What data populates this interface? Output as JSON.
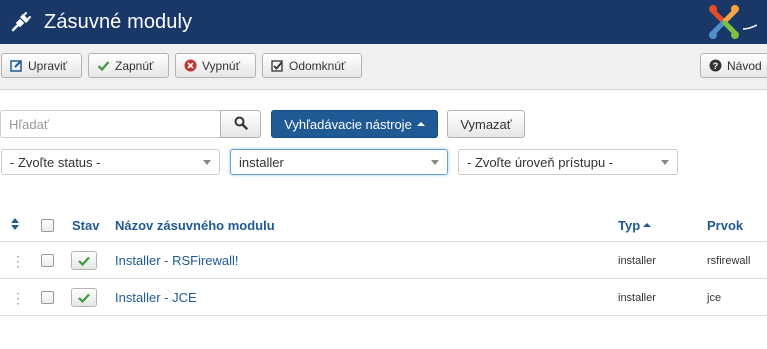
{
  "header": {
    "title": "Zásuvné moduly",
    "plug_icon": "plug-icon",
    "logo_icon": "joomla-logo-icon",
    "colors": {
      "bar": "#1a3867",
      "logo_red": "#e44d26",
      "logo_orange": "#f9a541",
      "logo_green": "#7ac143",
      "logo_blue": "#5091cd"
    }
  },
  "toolbar": {
    "edit_label": "Upraviť",
    "enable_label": "Zapnúť",
    "disable_label": "Vypnúť",
    "checkin_label": "Odomknúť",
    "help_label": "Návod"
  },
  "search": {
    "placeholder": "Hľadať",
    "tools_label": "Vyhľadávacie nástroje",
    "clear_label": "Vymazať"
  },
  "filters": {
    "status": "- Zvoľte status -",
    "folder": "installer",
    "access": "- Zvoľte úroveň prístupu -"
  },
  "table": {
    "headers": {
      "status": "Stav",
      "name": "Názov zásuvného modulu",
      "type": "Typ",
      "element": "Prvok"
    },
    "rows": [
      {
        "name": "Installer - RSFirewall!",
        "type": "installer",
        "element": "rsfirewall",
        "enabled": true
      },
      {
        "name": "Installer - JCE",
        "type": "installer",
        "element": "jce",
        "enabled": true
      }
    ]
  },
  "colors": {
    "primary": "#1f5a94",
    "success_check": "#3c9a3c",
    "danger": "#bd362f"
  }
}
